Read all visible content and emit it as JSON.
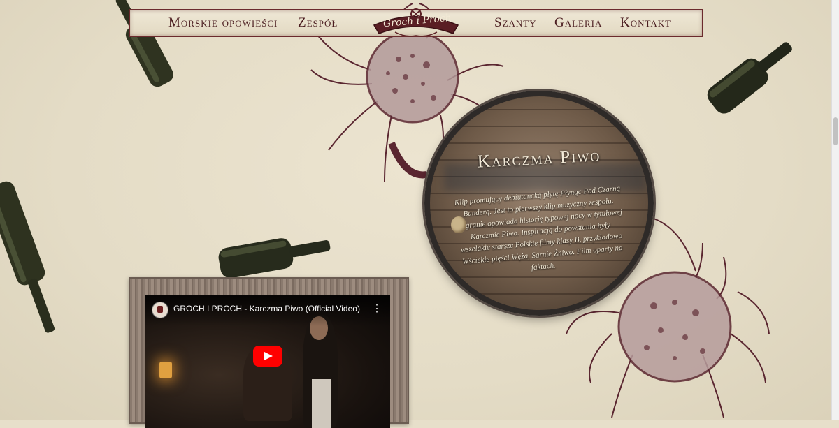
{
  "nav": {
    "items": [
      "Morskie opowieści",
      "Zespół",
      "Szanty",
      "Galeria",
      "Kontakt"
    ],
    "logo_text": "Groch i Proch"
  },
  "feature": {
    "title": "Karczma Piwo",
    "description": "Klip promujący debiutancką płytę Płynąc Pod Czarną Banderą. Jest to pierwszy klip muzyczny zespołu. Nagranie opowiada historię typowej nocy w tytułowej Karczmie Piwo. Inspiracją do powstania były wszelakie starsze Polskie filmy klasy B, przykładowo Wściekłe pięści Węża, Sarnie Żniwo. Film oparty na faktach."
  },
  "video": {
    "title": "GROCH I PROCH - Karczma Piwo (Official Video)",
    "menu_icon": "more-vert-icon",
    "play_icon": "youtube-play-icon"
  },
  "colors": {
    "background": "#e7dfca",
    "accent": "#6b2a2d",
    "nav_text": "#4b1d20",
    "play_red": "#ff0000"
  }
}
